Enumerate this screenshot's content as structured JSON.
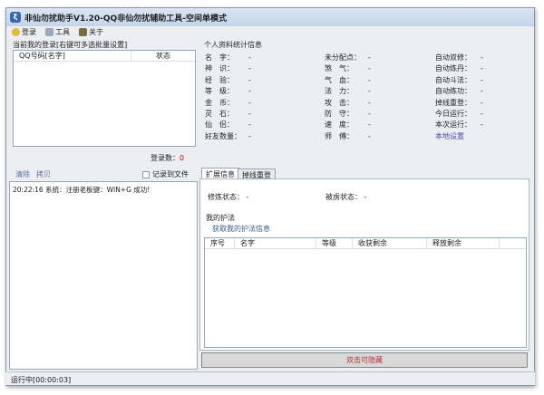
{
  "title": "非仙勿扰助手V1.20-QQ非仙勿扰辅助工具-空间单模式",
  "toolbar": {
    "login": "登录",
    "tools": "工具",
    "about": "关于"
  },
  "left": {
    "group_label": "当前我的登录[右键可多选批量设置]",
    "columns": [
      "QQ号码[名字]",
      "状态"
    ],
    "login_count_label": "登录数：",
    "login_count": "0",
    "clear": "清除",
    "copy": "拷贝",
    "log_to_file": "记录到文件",
    "log": "20:22:16 系统：注册老板键：WIN+G 成功!"
  },
  "stats": {
    "title": "个人资料统计信息",
    "col1": [
      [
        "名　字：",
        "-"
      ],
      [
        "神　识：",
        "-"
      ],
      [
        "经　验：",
        "-"
      ],
      [
        "等　级：",
        "-"
      ],
      [
        "金　币：",
        "-"
      ],
      [
        "灵　石：",
        "-"
      ],
      [
        "仙　侣：",
        "-"
      ],
      [
        "好友数量：",
        "-"
      ]
    ],
    "col2": [
      [
        "未分配点：",
        "-"
      ],
      [
        "煞　气：",
        "-"
      ],
      [
        "气　血：",
        "-"
      ],
      [
        "法　力：",
        "-"
      ],
      [
        "攻　击：",
        "-"
      ],
      [
        "防　守：",
        "-"
      ],
      [
        "速　度：",
        "-"
      ],
      [
        "师　傅：",
        "-"
      ]
    ],
    "col3": [
      [
        "自动双修：",
        "-"
      ],
      [
        "自动炼丹：",
        "-"
      ],
      [
        "自动斗法：",
        "-"
      ],
      [
        "自动练功：",
        "-"
      ],
      [
        "掉线重登：",
        "-"
      ],
      [
        "今日运行：",
        "-"
      ],
      [
        "本次运行：",
        "-"
      ]
    ],
    "local_settings": "本地设置"
  },
  "tabs": [
    "扩展信息",
    "掉线重登"
  ],
  "ext": {
    "cultivate_label": "修炼状态：",
    "cultivate": "-",
    "captured_label": "被虏状态：",
    "captured": "-",
    "protect_title": "我的护法",
    "fetch": "获取我的护法信息",
    "columns": [
      "序号",
      "名字",
      "等级",
      "收获剩余",
      "释放剩余"
    ]
  },
  "hide_button": "双击可隐藏",
  "status": "运行中[00:00:03]"
}
